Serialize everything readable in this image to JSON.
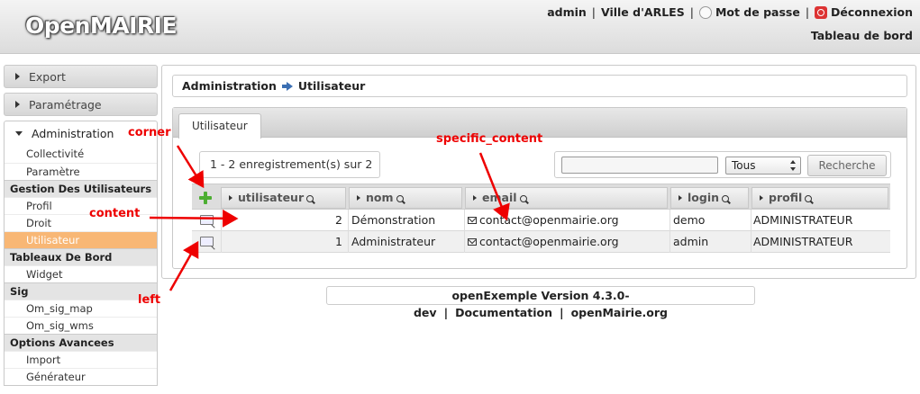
{
  "header": {
    "logo": "OpenMAIRIE",
    "user": "admin",
    "city": "Ville d'ARLES",
    "password_link": "Mot de passe",
    "logout_link": "Déconnexion",
    "dashboard_link": "Tableau de bord"
  },
  "sidebar": {
    "export": "Export",
    "settings": "Paramétrage",
    "administration": "Administration",
    "items": {
      "collectivite": "Collectivité",
      "parametre": "Paramètre",
      "cat_users": "Gestion Des Utilisateurs",
      "profil": "Profil",
      "droit": "Droit",
      "utilisateur": "Utilisateur",
      "cat_dashboard": "Tableaux De Bord",
      "widget": "Widget",
      "cat_sig": "Sig",
      "om_sig_map": "Om_sig_map",
      "om_sig_wms": "Om_sig_wms",
      "cat_advanced": "Options Avancees",
      "import": "Import",
      "generateur": "Générateur"
    }
  },
  "breadcrumb": {
    "parent": "Administration",
    "current": "Utilisateur"
  },
  "tab": {
    "label": "Utilisateur"
  },
  "pager": {
    "text": "1 - 2 enregistrement(s) sur 2"
  },
  "search": {
    "input_value": "",
    "select_value": "Tous",
    "button": "Recherche"
  },
  "table": {
    "columns": [
      "utilisateur",
      "nom",
      "email",
      "login",
      "profil"
    ],
    "rows": [
      {
        "id": "2",
        "nom": "Démonstration",
        "email": "contact@openmairie.org",
        "login": "demo",
        "profil": "ADMINISTRATEUR"
      },
      {
        "id": "1",
        "nom": "Administrateur",
        "email": "contact@openmairie.org",
        "login": "admin",
        "profil": "ADMINISTRATEUR"
      }
    ]
  },
  "footer": {
    "version": "openExemple Version 4.3.0-dev",
    "doc": "Documentation",
    "site": "openMairie.org"
  },
  "annotations": {
    "corner": "corner",
    "content": "content",
    "specific_content": "specific_content",
    "left": "left",
    "color": "#e00000"
  }
}
